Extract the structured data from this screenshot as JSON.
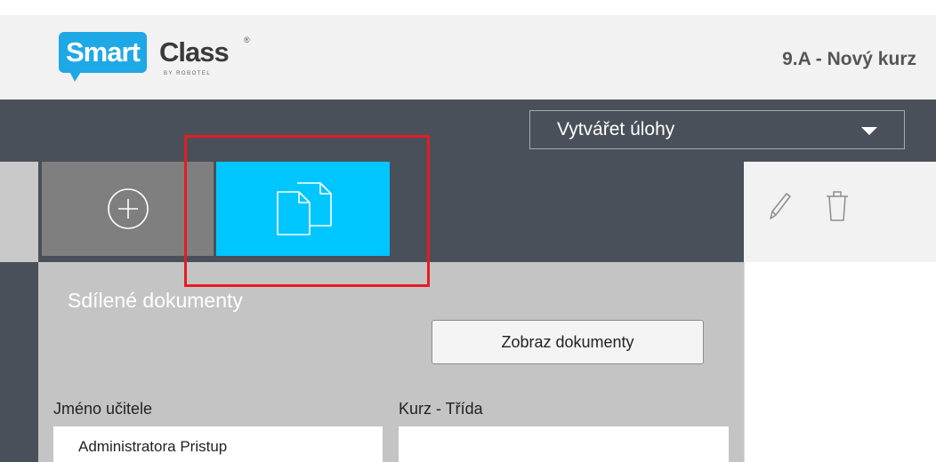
{
  "logo": {
    "smart": "Smart",
    "class": "Class",
    "reg": "®",
    "by": "BY ROBOTEL"
  },
  "header": {
    "title": "9.A - Nový kurz"
  },
  "toolbar": {
    "task_select_value": "Vytvářet úlohy"
  },
  "tabs": {
    "add": {
      "icon": "plus-circle-icon"
    },
    "documents": {
      "icon": "documents-icon"
    }
  },
  "actions": {
    "edit_icon": "pencil-icon",
    "delete_icon": "trash-icon"
  },
  "panel": {
    "title": "Sdílené dokumenty",
    "show_button": "Zobraz dokumenty",
    "teacher_label": "Jméno učitele",
    "course_label": "Kurz - Třída",
    "teacher_value": "Administratora Pristup",
    "course_value": ""
  },
  "colors": {
    "accent": "#00c6ff",
    "toolbar": "#4a5059",
    "logo_blue": "#1ea8e5",
    "highlight": "#e51c23"
  }
}
